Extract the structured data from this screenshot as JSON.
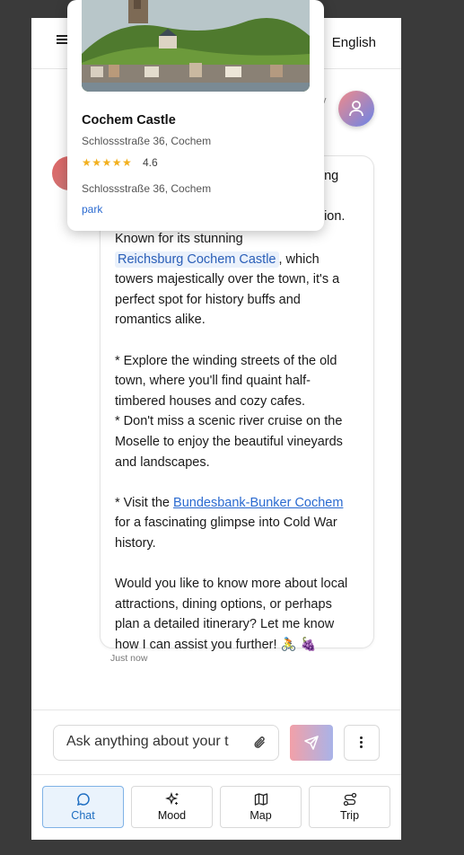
{
  "header": {
    "language": "English"
  },
  "message": {
    "hidden_fragments": {
      "right_1": "ong",
      "right_2": "gion."
    },
    "lines": [
      "Known for its stunning",
      "",
      "towers majestically over the town, it's a",
      "perfect spot for history buffs and",
      "romantics alike.",
      "",
      "* Explore the winding streets of the old",
      "town, where you'll find quaint half-",
      "timbered houses and cozy cafes.",
      "* Don't miss a scenic river cruise on the",
      "Moselle to enjoy the beautiful vineyards",
      "and landscapes.",
      "",
      "for a fascinating glimpse into Cold War",
      "history.",
      "",
      "Would you like to know more about local",
      "attractions, dining options, or perhaps",
      "plan a detailed itinerary? Let me know",
      "how I can assist you further! 🚴 🍇"
    ],
    "chip_place": "Reichsburg Cochem Castle",
    "chip_after": ", which",
    "visit_prefix": "* Visit the ",
    "visit_link": "Bundesbank-Bunker Cochem",
    "timestamp": "Just now"
  },
  "composer": {
    "placeholder": "Ask anything about your trip",
    "value": "Ask anything about your t"
  },
  "nav": [
    {
      "label": "Chat",
      "icon": "chat-bubble-icon",
      "active": true
    },
    {
      "label": "Mood",
      "icon": "sparkles-icon",
      "active": false
    },
    {
      "label": "Map",
      "icon": "map-icon",
      "active": false
    },
    {
      "label": "Trip",
      "icon": "route-icon",
      "active": false
    }
  ],
  "popup": {
    "title": "Cochem Castle",
    "address": "Schlossstraße 36, Cochem",
    "rating": "4.6",
    "stars": "★★★★★",
    "address_2": "Schlossstraße 36, Cochem",
    "category": "park"
  },
  "colors": {
    "accent": "#1d6dc1",
    "link": "#2a6ad0",
    "star": "#f2b01e"
  }
}
